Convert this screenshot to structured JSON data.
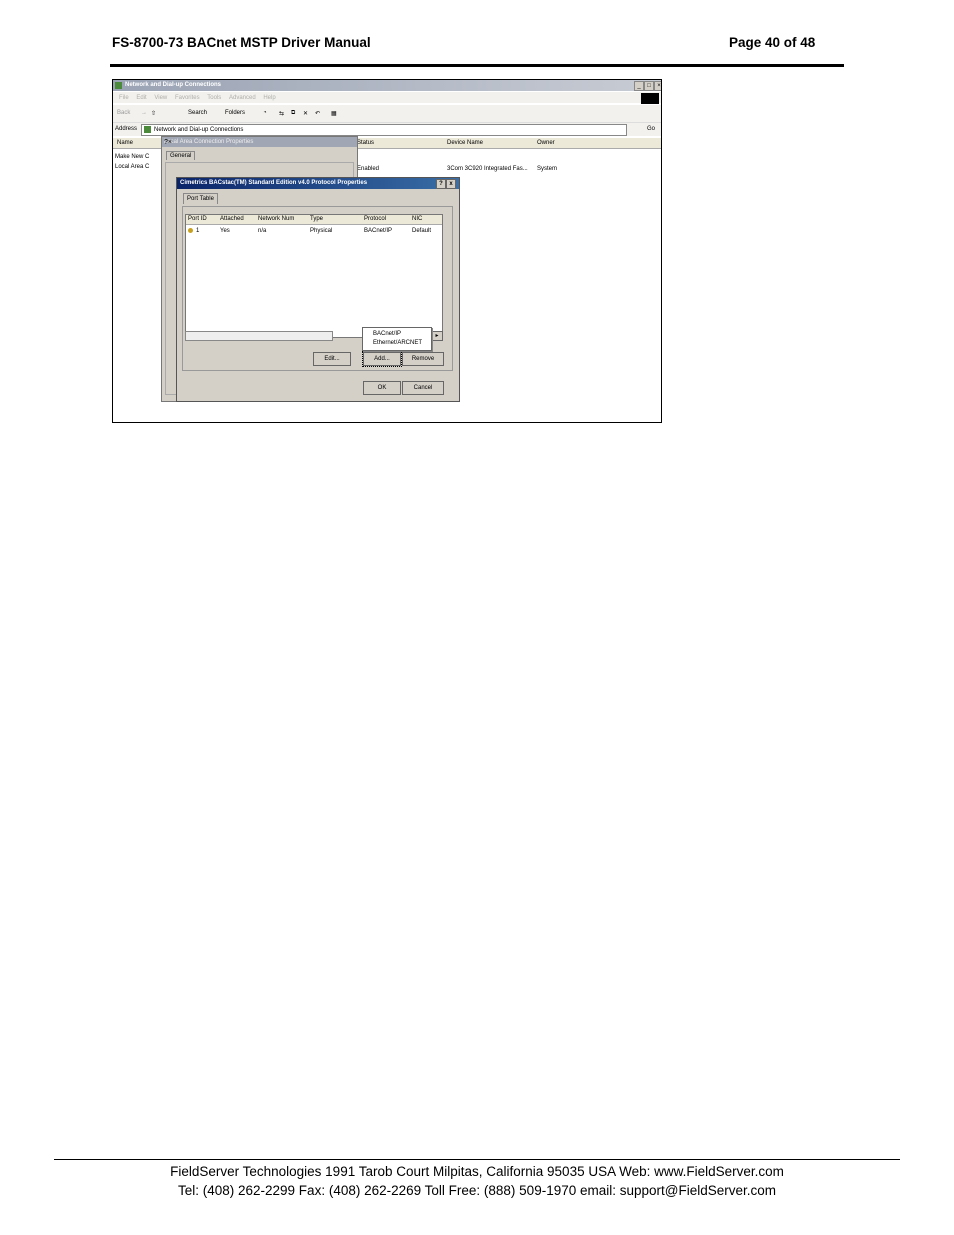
{
  "header": {
    "title": "FS-8700-73 BACnet MSTP Driver Manual",
    "page": "Page 40 of 48"
  },
  "screenshot": {
    "main_window": {
      "title": "Network and Dial-up Connections",
      "menu": [
        "File",
        "Edit",
        "View",
        "Favorites",
        "Tools",
        "Advanced",
        "Help"
      ],
      "toolbar": {
        "back": "Back",
        "search": "Search",
        "folders": "Folders"
      },
      "address_label": "Address",
      "address_value": "Network and Dial-up Connections",
      "go": "Go",
      "columns": {
        "name": "Name",
        "status": "Status",
        "device_name": "Device Name",
        "owner": "Owner"
      },
      "items": [
        "Make New C",
        "Local Area C"
      ],
      "row": {
        "status": "Enabled",
        "device": "3Com 3C920 Integrated Fas...",
        "owner": "System"
      }
    },
    "lac_dialog": {
      "title": "Local Area Connection Properties",
      "help": "?",
      "close": "x",
      "tab": "General"
    },
    "bacstac_dialog": {
      "title": "Cimetrics BACstac(TM) Standard Edition v4.0 Protocol Properties",
      "help": "?",
      "close": "x",
      "tab": "Port Table",
      "columns": [
        "Port ID",
        "Attached",
        "Network Num",
        "Type",
        "Protocol",
        "NIC"
      ],
      "row": [
        "1",
        "Yes",
        "n/a",
        "Physical",
        "BACnet/IP",
        "Default"
      ],
      "buttons": {
        "edit": "Edit...",
        "add": "Add...",
        "remove": "Remove",
        "ok": "OK",
        "cancel": "Cancel"
      },
      "popup_items": [
        "BACnet/IP",
        "Ethernet/ARCNET"
      ]
    }
  },
  "footer": {
    "line1": "FieldServer Technologies 1991 Tarob Court Milpitas, California 95035 USA   Web: www.FieldServer.com",
    "line2": "Tel: (408) 262-2299   Fax: (408) 262-2269   Toll Free: (888) 509-1970   email: support@FieldServer.com"
  }
}
